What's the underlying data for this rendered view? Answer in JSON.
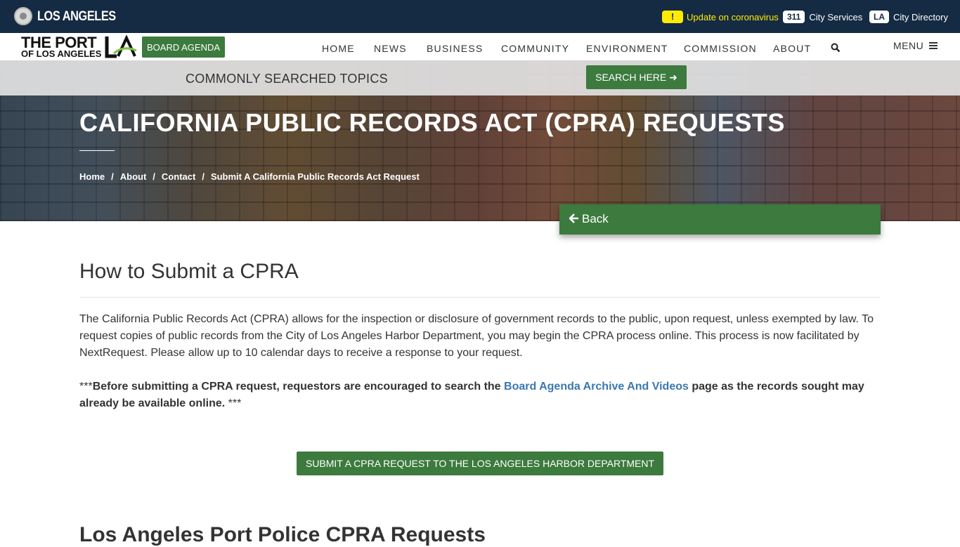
{
  "citybar": {
    "city_name": "LOS ANGELES",
    "alert_badge": "!",
    "alert_text": "Update on coronavirus",
    "services_badge": "311",
    "services_label": "City Services",
    "directory_badge": "LA",
    "directory_label": "City Directory",
    "colors": {
      "background": "#142b43",
      "alert": "#ffec00"
    }
  },
  "nav": {
    "logo_line1": "THE PORT",
    "logo_line2": "OF LOS ANGELES",
    "logo_mark": "LA",
    "board_agenda": "BOARD AGENDA",
    "items": [
      "HOME",
      "NEWS",
      "BUSINESS",
      "COMMUNITY",
      "ENVIRONMENT",
      "COMMISSION",
      "ABOUT"
    ],
    "search_icon": "search-icon",
    "menu_label": "MENU",
    "accent": "#3c7a3e"
  },
  "topics": {
    "label": "COMMONLY SEARCHED TOPICS",
    "search_button": "SEARCH HERE"
  },
  "hero": {
    "title": "CALIFORNIA PUBLIC RECORDS ACT (CPRA) REQUESTS",
    "breadcrumb": [
      "Home",
      "About",
      "Contact",
      "Submit A California Public Records Act Request"
    ],
    "back_label": "Back"
  },
  "content": {
    "heading": "How to Submit a CPRA",
    "paragraph": "The California Public Records Act (CPRA) allows for the inspection or disclosure of government records to the public, upon request, unless exempted by law. To request copies of public records from the City of Los Angeles Harbor Department, you may begin the CPRA process online. This process is now facilitated by NextRequest. Please allow up to 10 calendar days to receive a response to your request.",
    "note_prefix": "***",
    "note_bold_1": "Before submitting a CPRA request, requestors are encouraged to search the ",
    "note_link": "Board Agenda Archive And Videos",
    "note_bold_2": " page as the records sought may already be available online.",
    "note_suffix": " ***",
    "submit_button": "SUBMIT A CPRA REQUEST TO THE LOS ANGELES HARBOR DEPARTMENT",
    "heading2": "Los Angeles Port Police CPRA Requests"
  }
}
